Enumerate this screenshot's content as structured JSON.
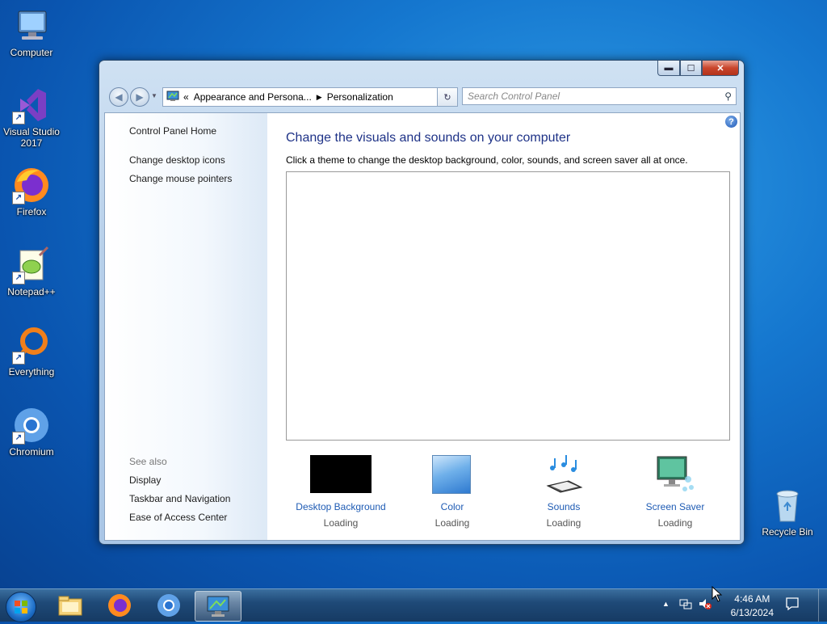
{
  "desktop": {
    "icons": [
      {
        "label": "Computer",
        "icon": "computer-icon"
      },
      {
        "label": "Visual Studio 2017",
        "icon": "visual-studio-icon"
      },
      {
        "label": "Firefox",
        "icon": "firefox-icon"
      },
      {
        "label": "Notepad++",
        "icon": "notepad-plus-plus-icon"
      },
      {
        "label": "Everything",
        "icon": "everything-search-icon"
      },
      {
        "label": "Chromium",
        "icon": "chromium-icon"
      },
      {
        "label": "Recycle Bin",
        "icon": "recycle-bin-icon"
      }
    ]
  },
  "window": {
    "address": {
      "overflow": "«",
      "crumb1": "Appearance and Persona...",
      "crumb2": "Personalization"
    },
    "search_placeholder": "Search Control Panel",
    "left_pane": {
      "home": "Control Panel Home",
      "links": [
        "Change desktop icons",
        "Change mouse pointers"
      ],
      "see_also_label": "See also",
      "see_also": [
        "Display",
        "Taskbar and Navigation",
        "Ease of Access Center"
      ]
    },
    "main": {
      "heading": "Change the visuals and sounds on your computer",
      "subtext": "Click a theme to change the desktop background, color, sounds, and screen saver all at once."
    },
    "options": [
      {
        "label": "Desktop Background",
        "status": "Loading"
      },
      {
        "label": "Color",
        "status": "Loading"
      },
      {
        "label": "Sounds",
        "status": "Loading"
      },
      {
        "label": "Screen Saver",
        "status": "Loading"
      }
    ]
  },
  "taskbar": {
    "time": "4:46 AM",
    "date": "6/13/2024"
  }
}
